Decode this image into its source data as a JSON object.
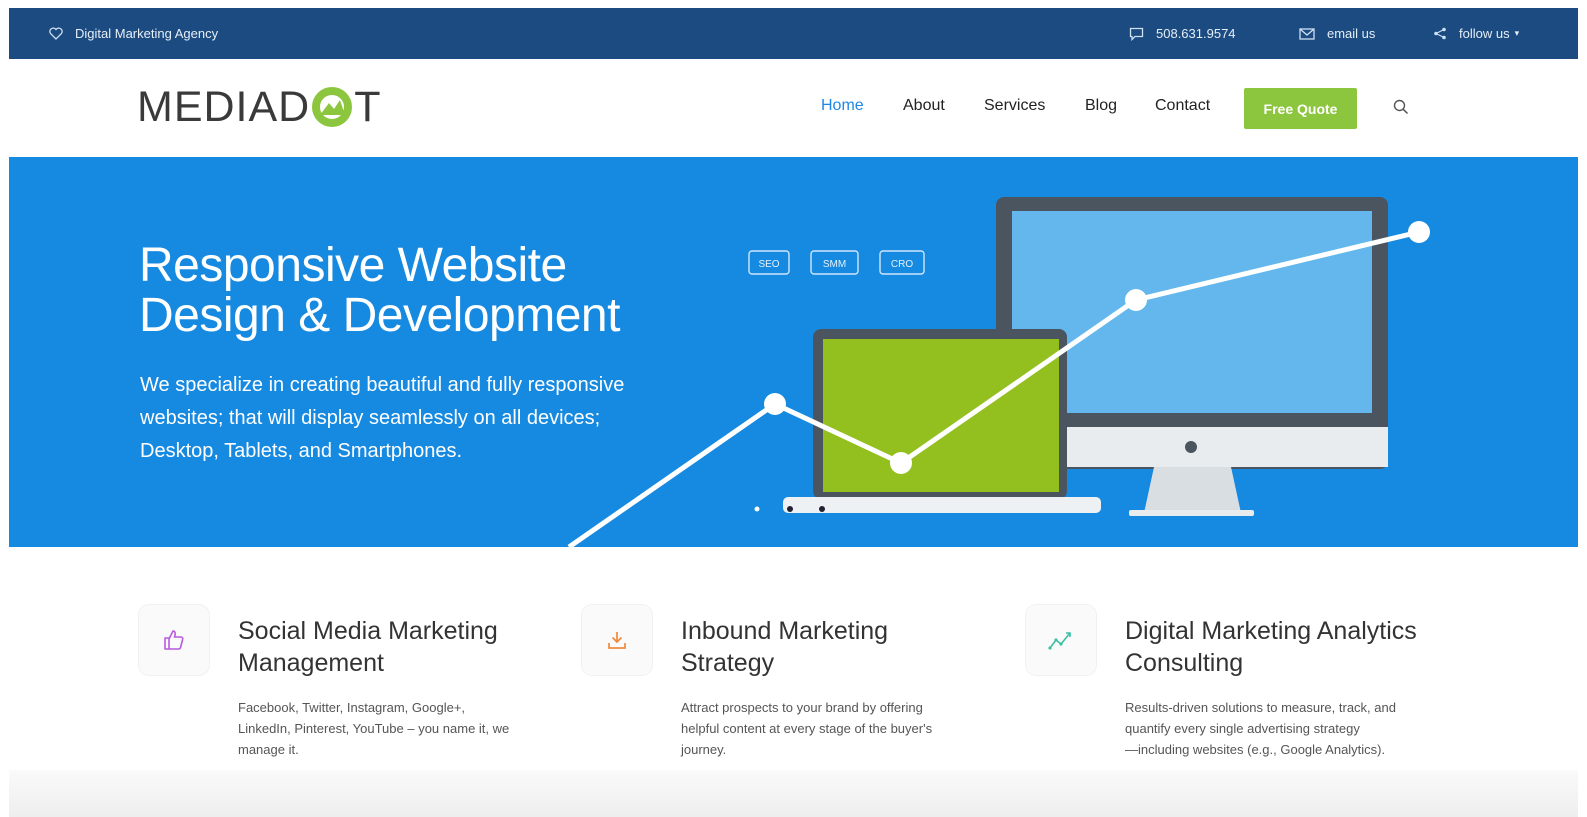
{
  "topbar": {
    "tagline": "Digital Marketing Agency",
    "phone": "508.631.9574",
    "email": "email us",
    "follow": "follow us"
  },
  "brand": {
    "logo_left": "MEDIAD",
    "logo_right": "T",
    "accent_green": "#8cc63f",
    "accent_blue": "#1e88e5"
  },
  "nav": {
    "items": [
      "Home",
      "About",
      "Services",
      "Blog",
      "Contact"
    ],
    "active": "Home",
    "cta": "Free Quote"
  },
  "hero": {
    "title_line1": "Responsive Website",
    "title_line2": "Design & Development",
    "body_line1": "We specialize in creating beautiful and fully responsive",
    "body_line2": "websites; that will display seamlessly on all devices;",
    "body_line3": "Desktop, Tablets, and Smartphones.",
    "badges": [
      "SEO",
      "SMM",
      "CRO"
    ]
  },
  "services": [
    {
      "icon": "thumbs-up-icon",
      "title_line1": "Social Media Marketing",
      "title_line2": "Management",
      "desc_line1": "Facebook, Twitter, Instagram, Google+,",
      "desc_line2": "LinkedIn, Pinterest, YouTube – you name it, we",
      "desc_line3": "manage it."
    },
    {
      "icon": "download-icon",
      "title_line1": "Inbound Marketing",
      "title_line2": "Strategy",
      "desc_line1": "Attract prospects to your brand by offering",
      "desc_line2": "helpful content at every stage of the buyer's",
      "desc_line3": "journey."
    },
    {
      "icon": "trend-line-icon",
      "title_line1": "Digital Marketing Analytics",
      "title_line2": "Consulting",
      "desc_line1": "Results-driven solutions to measure, track, and",
      "desc_line2": "quantify every single advertising strategy",
      "desc_line3": "—including websites (e.g., Google Analytics)."
    }
  ]
}
